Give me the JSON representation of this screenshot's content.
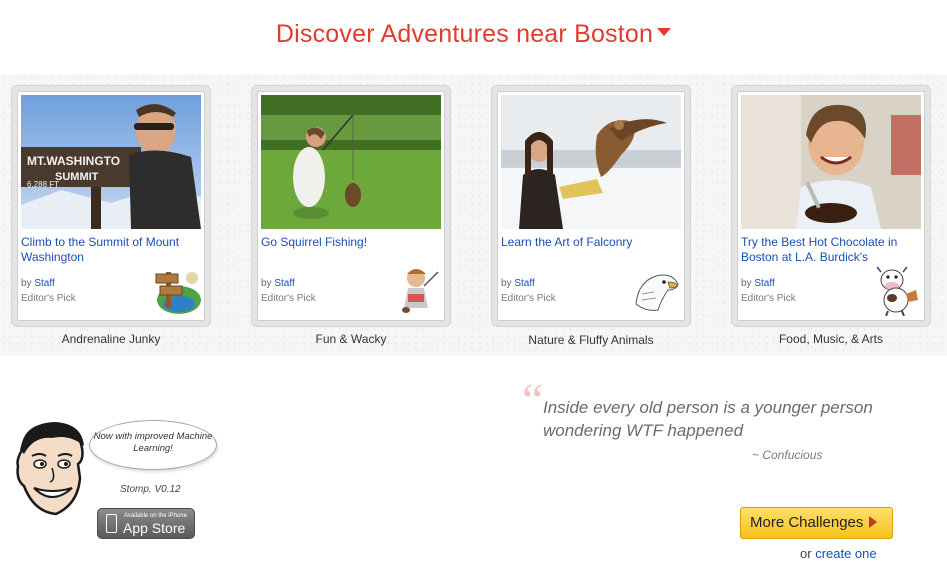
{
  "header": {
    "title": "Discover Adventures near Boston"
  },
  "cards": [
    {
      "title": "Climb to the Summit of Mount Washington",
      "by_prefix": "by",
      "author": "Staff",
      "pick": "Editor's Pick",
      "category": "Andrenaline Junky",
      "badge_icon": "signpost-icon",
      "photo": "mountain-summit-photo"
    },
    {
      "title": "Go Squirrel Fishing!",
      "by_prefix": "by",
      "author": "Staff",
      "pick": "Editor's Pick",
      "category": "Fun & Wacky",
      "badge_icon": "cartoon-character-icon",
      "photo": "squirrel-fishing-photo"
    },
    {
      "title": "Learn the Art of Falconry",
      "by_prefix": "by",
      "author": "Staff",
      "pick": "Editor's Pick",
      "category": "Nature & Fluffy Animals",
      "badge_icon": "eagle-icon",
      "photo": "falconry-photo"
    },
    {
      "title": "Try the Best Hot Chocolate in Boston at L.A. Burdick's",
      "by_prefix": "by",
      "author": "Staff",
      "pick": "Editor's Pick",
      "category": "Food, Music, & Arts",
      "badge_icon": "cow-icon",
      "photo": "hot-chocolate-photo"
    }
  ],
  "quote": {
    "text": "Inside every old person is a younger person wondering WTF happened",
    "author": "~ Confucious"
  },
  "mascot": {
    "bubble": "Now with improved Machine Learning!",
    "version": "Stomp, V0.12"
  },
  "appstore": {
    "small": "Available on the iPhone",
    "big": "App Store"
  },
  "cta": {
    "button": "More Challenges",
    "or": "or",
    "create": "create one"
  },
  "colors": {
    "accent": "#e03c2e",
    "link": "#1a4fb0",
    "button": "#f7c21a"
  }
}
